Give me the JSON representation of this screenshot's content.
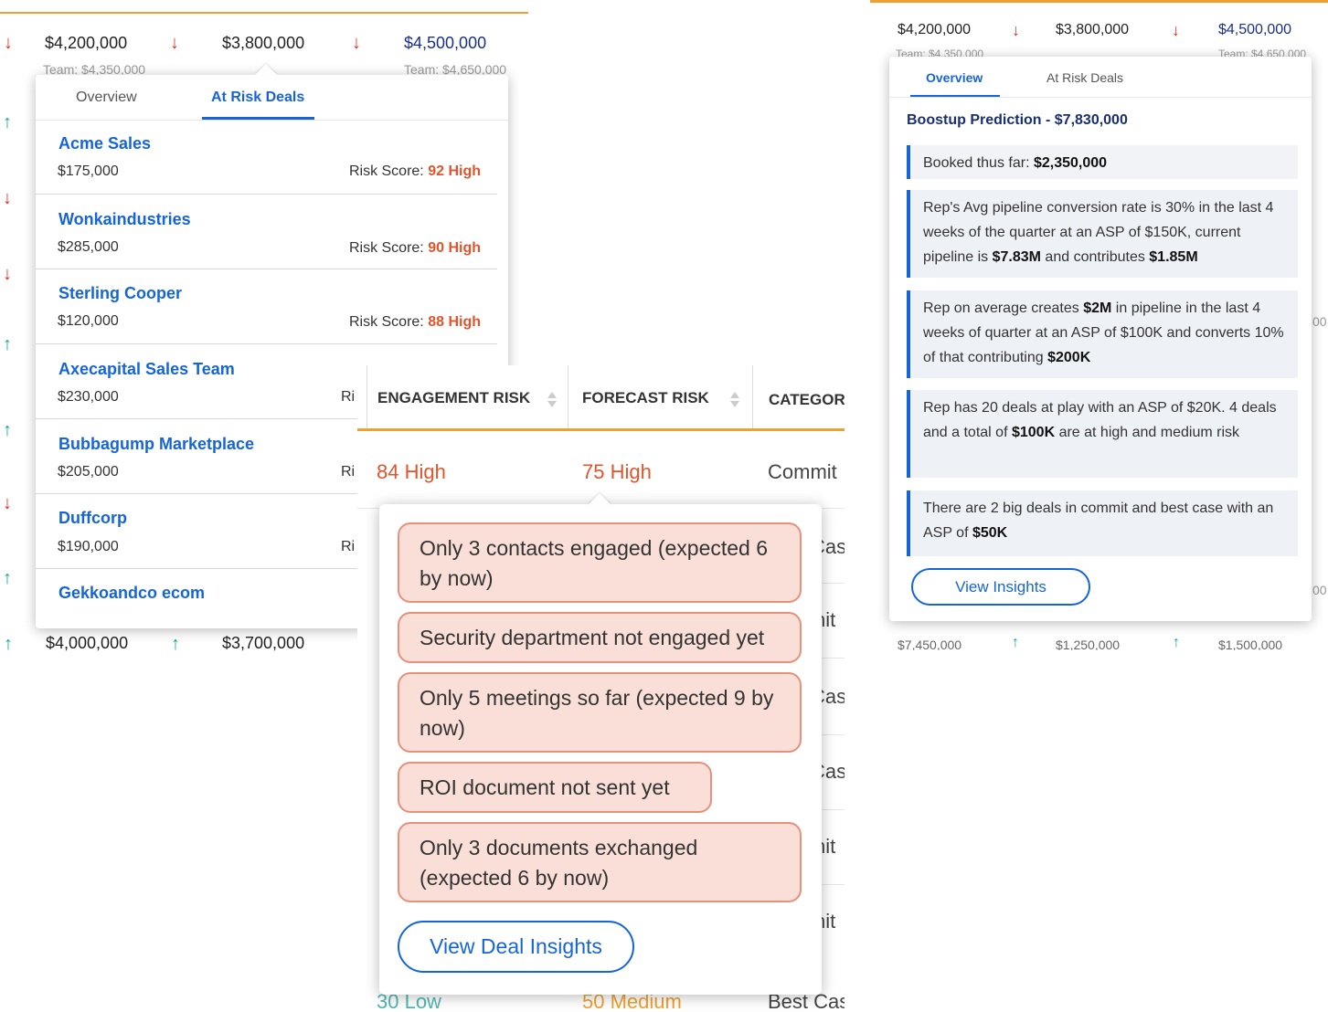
{
  "left": {
    "header_values": {
      "v1": "$4,200,000",
      "v2": "$3,800,000",
      "v3": "$4,500,000",
      "team1": "Team: $4,350,000",
      "team2": "Team: $4,650,000"
    },
    "footer_values": {
      "v1": "$4,000,000",
      "v2": "$3,700,000"
    },
    "tabs": [
      {
        "label": "Overview",
        "active": false
      },
      {
        "label": "At Risk Deals",
        "active": true
      }
    ],
    "risk_label": "Risk Score:",
    "deals": [
      {
        "name": "Acme Sales",
        "amount": "$175,000",
        "score": "92 High"
      },
      {
        "name": "Wonkaindustries",
        "amount": "$285,000",
        "score": "90 High"
      },
      {
        "name": "Sterling Cooper",
        "amount": "$120,000",
        "score": "88 High"
      },
      {
        "name": "Axecapital Sales Team",
        "amount": "$230,000",
        "score": "Ri"
      },
      {
        "name": "Bubbagump Marketplace",
        "amount": "$205,000",
        "score": "Ri"
      },
      {
        "name": "Duffcorp",
        "amount": "$190,000",
        "score": "Ri"
      },
      {
        "name": "Gekkoandco ecom"
      }
    ]
  },
  "middle": {
    "columns": [
      {
        "label": "ENGAGEMENT RISK"
      },
      {
        "label": "FORECAST RISK"
      },
      {
        "label": "CATEGOR"
      }
    ],
    "row": {
      "engagement": "84 High",
      "forecast": "75 High",
      "category": "Commit"
    },
    "side_fragments": [
      "Cas",
      "nit",
      "Cas",
      "Cas",
      "nit",
      "nit"
    ],
    "insights": [
      "Only 3 contacts engaged (expected 6 by now)",
      "Security department not engaged yet",
      "Only 5 meetings so far (expected 9 by now)",
      "ROI document not sent yet",
      "Only 3 documents exchanged (expected 6 by now)"
    ],
    "button_label": "View Deal Insights",
    "bottom_row": {
      "engagement": "30 Low",
      "forecast": "50 Medium",
      "category": "Best Cas"
    }
  },
  "right": {
    "header_values": {
      "v1": "$4,200,000",
      "v2": "$3,800,000",
      "v3": "$4,500,000",
      "team1": "Team: $4,350,000",
      "team2": "Team: $4,650,000"
    },
    "footer_values": {
      "v1": "$7,450,000",
      "v2": "$1,250,000",
      "v3": "$1,500,000"
    },
    "tabs": [
      {
        "label": "Overview",
        "active": true
      },
      {
        "label": "At Risk Deals",
        "active": false
      }
    ],
    "prediction_title": "Boostup Prediction - $7,830,000",
    "booked": {
      "label": "Booked thus far:",
      "value": "$2,350,000"
    },
    "insights": [
      {
        "t1": "Rep's Avg pipeline conversion rate is 30% in the last 4 weeks of the quarter at an ASP of $150K, current pipeline is ",
        "b1": "$7.83M",
        "t2": " and contributes ",
        "b2": "$1.85M",
        "t3": ""
      },
      {
        "t1": "Rep on average creates ",
        "b1": "$2M",
        "t2": " in pipeline in the last 4 weeks of quarter at an ASP of $100K and converts 10% of that contributing ",
        "b2": "$200K",
        "t3": ""
      },
      {
        "t1": "Rep has 20 deals at play with an ASP of $20K. 4 deals and a total of ",
        "b1": "$100K",
        "t2": " are at high and medium risk",
        "b2": "",
        "t3": ""
      },
      {
        "t1": "There are 2 big deals in commit and best case with an ASP of ",
        "b1": "$50K",
        "t2": "",
        "b2": "",
        "t3": ""
      }
    ],
    "button_label": "View Insights",
    "side_fragments": [
      "00",
      "00"
    ]
  },
  "colors": {
    "accent_blue": "#1565d8",
    "risk_high": "#e2542b",
    "arrow_up": "#16a89a",
    "arrow_down": "#e0322b",
    "chip_fill": "#f9dfd7",
    "chip_border": "#e7907a"
  },
  "icons": {
    "up": "↑",
    "down": "↓"
  }
}
